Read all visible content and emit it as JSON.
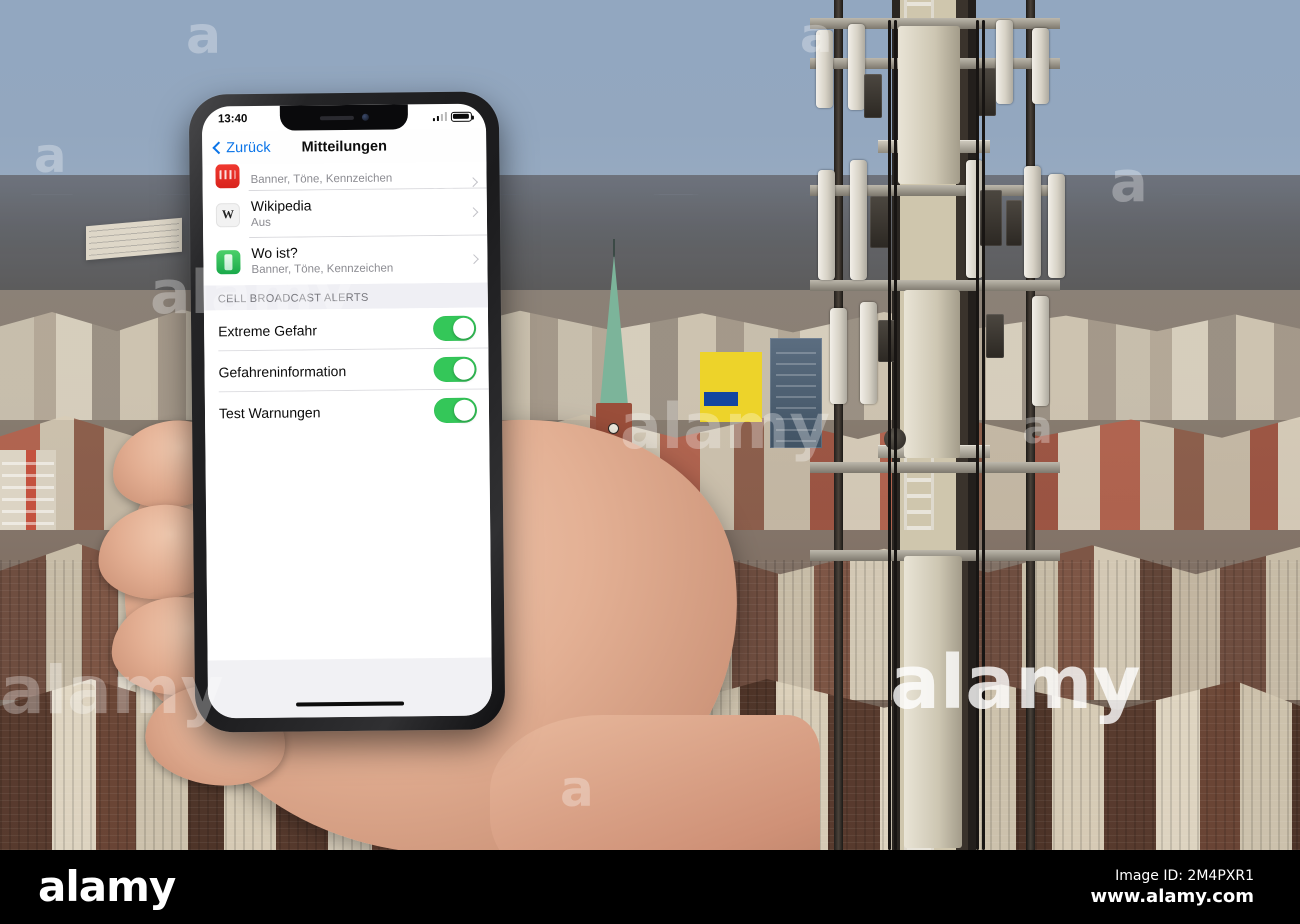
{
  "photo": {
    "scene_description": "Hand holding an iPhone showing iOS notification settings with Cell Broadcast Alerts, in front of a blurred city skyline and a mobile phone mast",
    "sky_color": "#92a7c0",
    "tower_name": "cell-tower"
  },
  "phone": {
    "status_bar": {
      "time": "13:40",
      "signal_icon": "signal-bars-icon",
      "battery_icon": "battery-icon"
    },
    "nav": {
      "back_label": "Zurück",
      "back_icon": "chevron-left-icon",
      "title": "Mitteilungen"
    },
    "apps": [
      {
        "name": "",
        "subtitle": "Banner, Töne, Kennzeichen",
        "icon": "red-app-icon",
        "chevron": "chevron-right-icon",
        "partial": true
      },
      {
        "name": "Wikipedia",
        "subtitle": "Aus",
        "icon": "wikipedia-icon",
        "chevron": "chevron-right-icon",
        "partial": false
      },
      {
        "name": "Wo ist?",
        "subtitle": "Banner, Töne, Kennzeichen",
        "icon": "find-my-icon",
        "chevron": "chevron-right-icon",
        "partial": false
      }
    ],
    "section": {
      "header": "CELL BROADCAST ALERTS",
      "toggle_on_color": "#34C759",
      "items": [
        {
          "label": "Extreme Gefahr",
          "state": "on"
        },
        {
          "label": "Gefahreninformation",
          "state": "on"
        },
        {
          "label": "Test Warnungen",
          "state": "on"
        }
      ]
    },
    "home_indicator": "home-indicator"
  },
  "watermark": {
    "letter": "a",
    "word": "alamy",
    "logo": "alamy",
    "image_id": "Image ID: 2M4PXR1",
    "site": "www.alamy.com"
  }
}
